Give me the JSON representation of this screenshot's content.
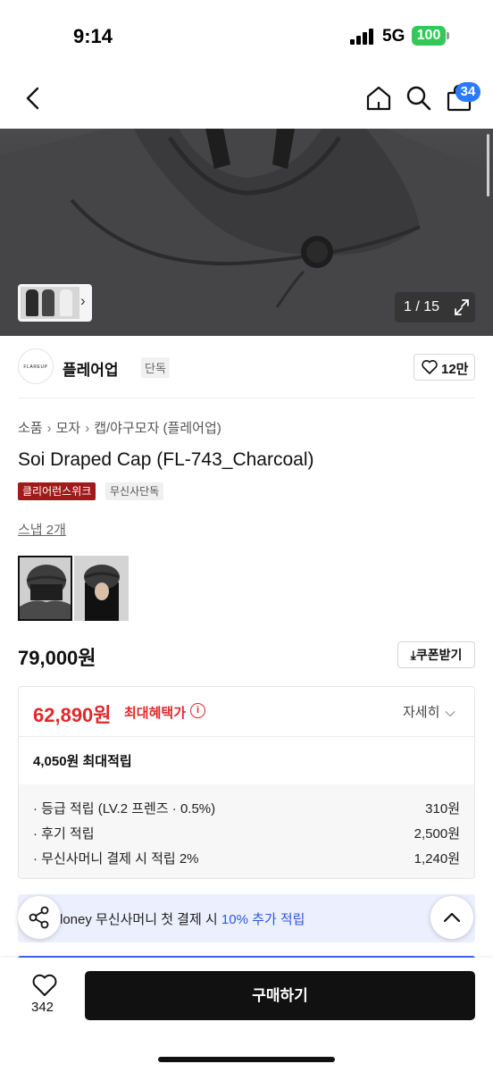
{
  "status": {
    "time": "9:14",
    "network": "5G",
    "battery": "100"
  },
  "nav": {
    "cart_count": "34"
  },
  "gallery": {
    "counter": "1 / 15"
  },
  "brand": {
    "logo_text": "FLAREUP",
    "name": "플레어업",
    "tag": "단독",
    "likes": "12만"
  },
  "breadcrumb": [
    "소품",
    "모자",
    "캡/야구모자 (플레어업)"
  ],
  "product": {
    "title": "Soi Draped Cap (FL-743_Charcoal)",
    "badge_promo": "클리어런스위크",
    "badge_exclusive": "무신사단독",
    "snap_link": "스냅 2개",
    "price": "79,000원",
    "coupon": "쿠폰받기"
  },
  "benefit": {
    "price": "62,890원",
    "label": "최대혜택가",
    "detail": "자세히",
    "points_head": "4,050원 최대적립",
    "rows": [
      {
        "label": "· 등급 적립 (LV.2 프렌즈 · 0.5%)",
        "value": "310원"
      },
      {
        "label": "· 후기 적립",
        "value": "2,500원"
      },
      {
        "label": "· 무신사머니 결제 시 적립 2%",
        "value": "1,240원"
      }
    ]
  },
  "money_banner": {
    "prefix": "loney 무신사머니 첫 결제 시 ",
    "highlight": "10% 추가 적립"
  },
  "bottom": {
    "wish_count": "342",
    "buy_label": "구매하기"
  },
  "colors": {
    "accent_red": "#e0282a",
    "brand_blue": "#2b7bff",
    "promo_badge": "#a11a1a",
    "money_blue": "#2a58e0"
  }
}
